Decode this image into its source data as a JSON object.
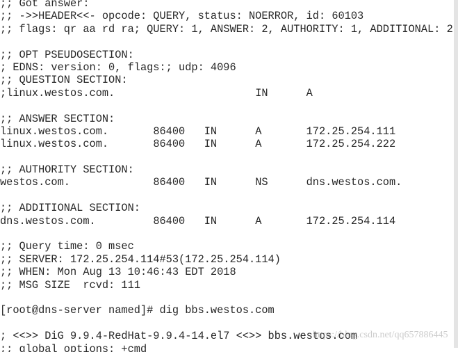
{
  "terminal": {
    "lines": [
      ";; Got answer:",
      ";; ->>HEADER<<- opcode: QUERY, status: NOERROR, id: 60103",
      ";; flags: qr aa rd ra; QUERY: 1, ANSWER: 2, AUTHORITY: 1, ADDITIONAL: 2",
      "",
      ";; OPT PSEUDOSECTION:",
      "; EDNS: version: 0, flags:; udp: 4096",
      ";; QUESTION SECTION:",
      ";linux.westos.com.\t\t\tIN\tA",
      "",
      ";; ANSWER SECTION:",
      "linux.westos.com.\t86400\tIN\tA\t172.25.254.111",
      "linux.westos.com.\t86400\tIN\tA\t172.25.254.222",
      "",
      ";; AUTHORITY SECTION:",
      "westos.com.\t\t86400\tIN\tNS\tdns.westos.com.",
      "",
      ";; ADDITIONAL SECTION:",
      "dns.westos.com.\t\t86400\tIN\tA\t172.25.254.114",
      "",
      ";; Query time: 0 msec",
      ";; SERVER: 172.25.254.114#53(172.25.254.114)",
      ";; WHEN: Mon Aug 13 10:46:43 EDT 2018",
      ";; MSG SIZE  rcvd: 111",
      "",
      "[root@dns-server named]# dig bbs.westos.com",
      "",
      "; <<>> DiG 9.9.4-RedHat-9.9.4-14.el7 <<>> bbs.westos.com",
      ";; global options: +cmd"
    ]
  },
  "watermark": "https://blog.csdn.net/qq657886445"
}
